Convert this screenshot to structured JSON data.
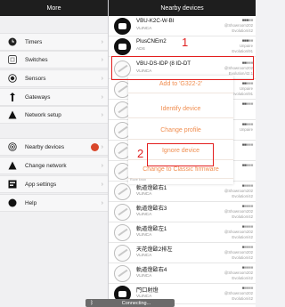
{
  "left_panel": {
    "title": "More",
    "items": [
      {
        "label": "Timers",
        "icon": "clock-icon"
      },
      {
        "label": "Switches",
        "icon": "switch-icon"
      },
      {
        "label": "Sensors",
        "icon": "sensor-icon"
      },
      {
        "label": "Gateways",
        "icon": "gateway-icon"
      },
      {
        "label": "Network setup",
        "icon": "network-icon"
      },
      {
        "label": "Nearby devices",
        "icon": "radar-icon",
        "notice": true
      },
      {
        "label": "Change network",
        "icon": "change-network-icon"
      },
      {
        "label": "App settings",
        "icon": "app-settings-icon"
      },
      {
        "label": "Help",
        "icon": "help-icon"
      }
    ]
  },
  "right_panel": {
    "title": "Nearby devices",
    "devices": [
      {
        "name": "VBU-K2C-W-BI",
        "vendor": "VLINCA",
        "detail": "@Showroom202",
        "detail2": "Evolution/42"
      },
      {
        "name": "PlusCNEm2",
        "vendor": "ADS",
        "detail": "Unpaire",
        "detail2": "Evolution/91"
      },
      {
        "name": "VBU-DS-IDP (8 ID-DT",
        "vendor": "VLINCA",
        "detail": "@Showroom202",
        "detail2": "Evolution/42.1"
      },
      {
        "name": "",
        "vendor": "",
        "detail": "Unpaire",
        "detail2": "Evolution/91"
      },
      {
        "name": "",
        "vendor": "",
        "detail": "",
        "detail2": ""
      },
      {
        "name": "",
        "vendor": "",
        "detail": "Unpaire",
        "detail2": ""
      },
      {
        "name": "",
        "vendor": "",
        "detail": "",
        "detail2": ""
      },
      {
        "name": "",
        "vendor": "",
        "detail": "",
        "detail2": ""
      },
      {
        "name": "軌道燈歐右1",
        "vendor": "VLINCA",
        "detail": "@Showroom202",
        "detail2": "Evolution/42"
      },
      {
        "name": "軌道燈歐右3",
        "vendor": "VLINCA",
        "detail": "@Showroom202",
        "detail2": "Evolution/42"
      },
      {
        "name": "軌道燈歐左1",
        "vendor": "VLINCA",
        "detail": "@Showroom202",
        "detail2": "Evolution/42"
      },
      {
        "name": "天花燈歐2排左",
        "vendor": "VLINCA",
        "detail": "@Showroom202",
        "detail2": "Evolution/42"
      },
      {
        "name": "軌道燈歐右4",
        "vendor": "VLINCA",
        "detail": "@Showroom202",
        "detail2": "Evolution/42"
      },
      {
        "name": "門口射燈",
        "vendor": "VLINCA",
        "detail": "@Showroom202",
        "detail2": "Evolution/42"
      }
    ]
  },
  "context_menu": {
    "options": [
      "Add to 'G322-2'",
      "Identify device",
      "Change profile",
      "Ignore device",
      "Change to Classic firmware"
    ],
    "footer_text": "Ruve knon"
  },
  "annotations": {
    "label_1": "1",
    "label_2": "2",
    "color": "#e31e1e"
  },
  "status": {
    "bluetooth_icon": "bluetooth-icon",
    "text": "Connecting..."
  },
  "colors": {
    "accent": "#f08d4f",
    "header": "#1e1e1e",
    "notice_badge": "#d9472b"
  }
}
